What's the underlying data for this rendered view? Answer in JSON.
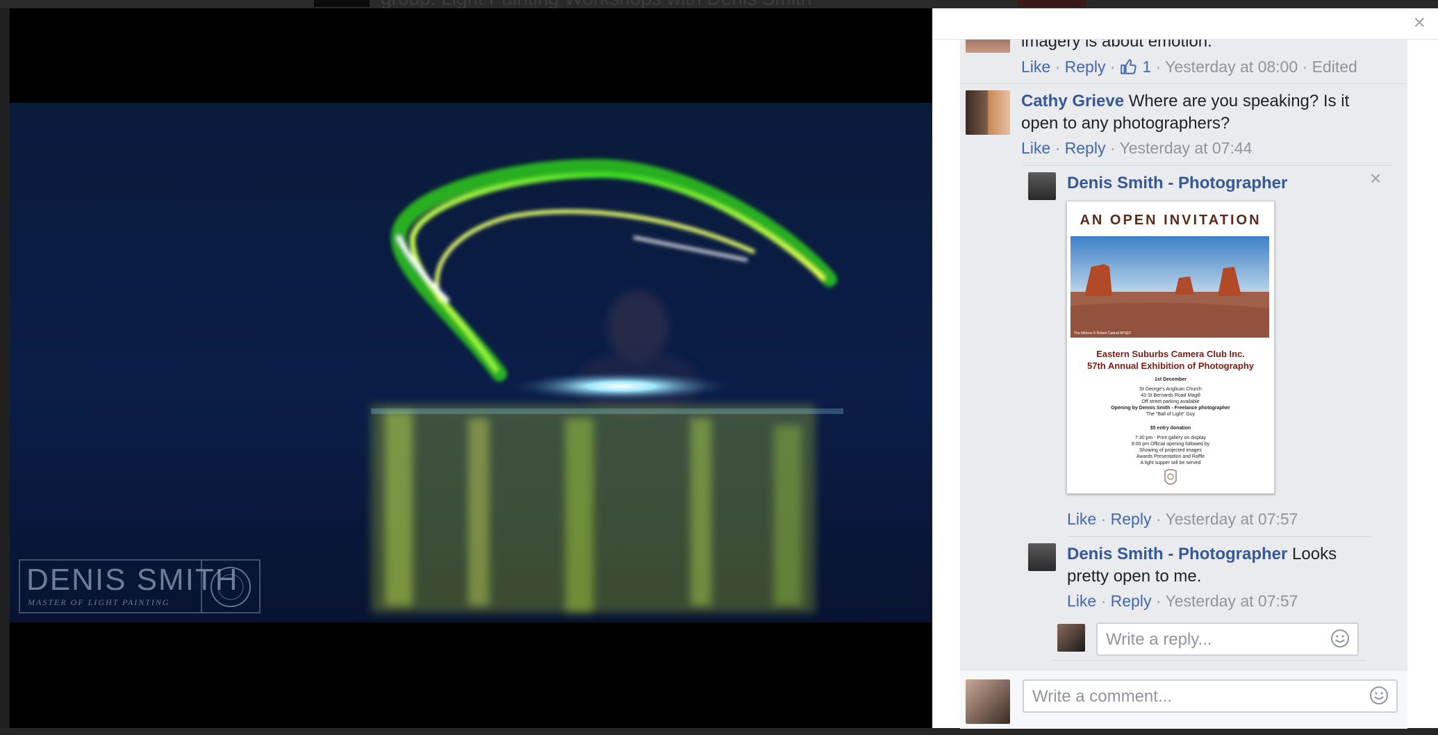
{
  "background_page": {
    "group_title": "group: Light Painting Workshops with Denis Smith"
  },
  "photo": {
    "watermark_name": "DENIS SMITH",
    "watermark_tagline": "MASTER OF LIGHT PAINTING"
  },
  "panel": {
    "close_icon": "close-icon",
    "close_glyph": "×"
  },
  "comments": [
    {
      "text": "imagery is about emotion.",
      "actions": {
        "like": "Like",
        "reply": "Reply",
        "like_count": "1",
        "time": "Yesterday at 08:00",
        "edited": "Edited"
      }
    },
    {
      "author": "Cathy Grieve",
      "text": "Where are you speaking? Is it open to any photographers?",
      "actions": {
        "like": "Like",
        "reply": "Reply",
        "time": "Yesterday at 07:44"
      },
      "replies": [
        {
          "author": "Denis Smith - Photographer",
          "attachment": {
            "title": "AN OPEN INVITATION",
            "photo_credit": "The Mittens © Robert Cattrall APSEF",
            "heading_line1": "Eastern Suburbs Camera Club Inc.",
            "heading_line2": "57th Annual Exhibition of Photography",
            "date": "1st December",
            "venue_line1": "St George's Anglican Church",
            "venue_line2": "43 St Bernards Road Magill",
            "venue_line3": "Off street parking available",
            "opening": "Opening by Dennis Smith - Freelance photographer",
            "opening_sub": "The \"Ball of Light\" Guy",
            "donation": "$5 entry donation",
            "sched1": "7:30 pm - Print gallery on display",
            "sched2": "8:00 pm Official opening followed by",
            "sched3": "Showing of projected images",
            "sched4": "Awards Presentation and Raffle",
            "sched5": "A light supper will be served"
          },
          "actions": {
            "like": "Like",
            "reply": "Reply",
            "time": "Yesterday at 07:57"
          }
        },
        {
          "author": "Denis Smith - Photographer",
          "text": "Looks pretty open to me.",
          "actions": {
            "like": "Like",
            "reply": "Reply",
            "time": "Yesterday at 07:57"
          }
        }
      ],
      "reply_placeholder": "Write a reply..."
    }
  ],
  "comment_placeholder": "Write a comment...",
  "separator": "·",
  "colors": {
    "link": "#4267b2",
    "name": "#365899",
    "meta": "#90949c",
    "thread_bg": "#e9ebee"
  }
}
